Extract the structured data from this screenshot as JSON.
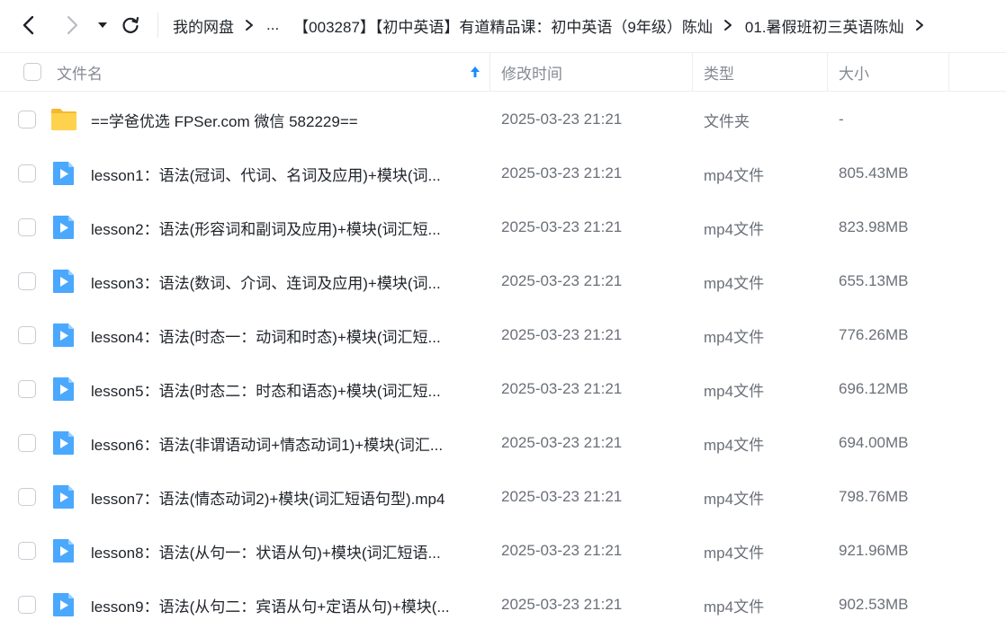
{
  "toolbar": {
    "icons": [
      "back-icon",
      "forward-icon",
      "dropdown-icon",
      "refresh-icon"
    ]
  },
  "breadcrumb": {
    "root": "我的网盘",
    "ellipsis": "...",
    "folder1": "【003287】【初中英语】有道精品课：初中英语（9年级）陈灿",
    "folder2": "01.暑假班初三英语陈灿"
  },
  "columns": {
    "name": "文件名",
    "modified": "修改时间",
    "type": "类型",
    "size": "大小",
    "sort_indicator": "up-arrow-icon"
  },
  "colors": {
    "accent": "#1a8cff",
    "folder": "#f7c948",
    "video": "#4aa8ff"
  },
  "files": [
    {
      "name": "==学爸优选 FPSer.com 微信 582229==",
      "modified": "2025-03-23 21:21",
      "type": "文件夹",
      "size": "-",
      "icon": "folder-icon"
    },
    {
      "name": "lesson1：语法(冠词、代词、名词及应用)+模块(词...",
      "modified": "2025-03-23 21:21",
      "type": "mp4文件",
      "size": "805.43MB",
      "icon": "video-file-icon"
    },
    {
      "name": "lesson2：语法(形容词和副词及应用)+模块(词汇短...",
      "modified": "2025-03-23 21:21",
      "type": "mp4文件",
      "size": "823.98MB",
      "icon": "video-file-icon"
    },
    {
      "name": "lesson3：语法(数词、介词、连词及应用)+模块(词...",
      "modified": "2025-03-23 21:21",
      "type": "mp4文件",
      "size": "655.13MB",
      "icon": "video-file-icon"
    },
    {
      "name": "lesson4：语法(时态一：动词和时态)+模块(词汇短...",
      "modified": "2025-03-23 21:21",
      "type": "mp4文件",
      "size": "776.26MB",
      "icon": "video-file-icon"
    },
    {
      "name": "lesson5：语法(时态二：时态和语态)+模块(词汇短...",
      "modified": "2025-03-23 21:21",
      "type": "mp4文件",
      "size": "696.12MB",
      "icon": "video-file-icon"
    },
    {
      "name": "lesson6：语法(非谓语动词+情态动词1)+模块(词汇...",
      "modified": "2025-03-23 21:21",
      "type": "mp4文件",
      "size": "694.00MB",
      "icon": "video-file-icon"
    },
    {
      "name": "lesson7：语法(情态动词2)+模块(词汇短语句型).mp4",
      "modified": "2025-03-23 21:21",
      "type": "mp4文件",
      "size": "798.76MB",
      "icon": "video-file-icon"
    },
    {
      "name": "lesson8：语法(从句一：状语从句)+模块(词汇短语...",
      "modified": "2025-03-23 21:21",
      "type": "mp4文件",
      "size": "921.96MB",
      "icon": "video-file-icon"
    },
    {
      "name": "lesson9：语法(从句二：宾语从句+定语从句)+模块(...",
      "modified": "2025-03-23 21:21",
      "type": "mp4文件",
      "size": "902.53MB",
      "icon": "video-file-icon"
    }
  ]
}
